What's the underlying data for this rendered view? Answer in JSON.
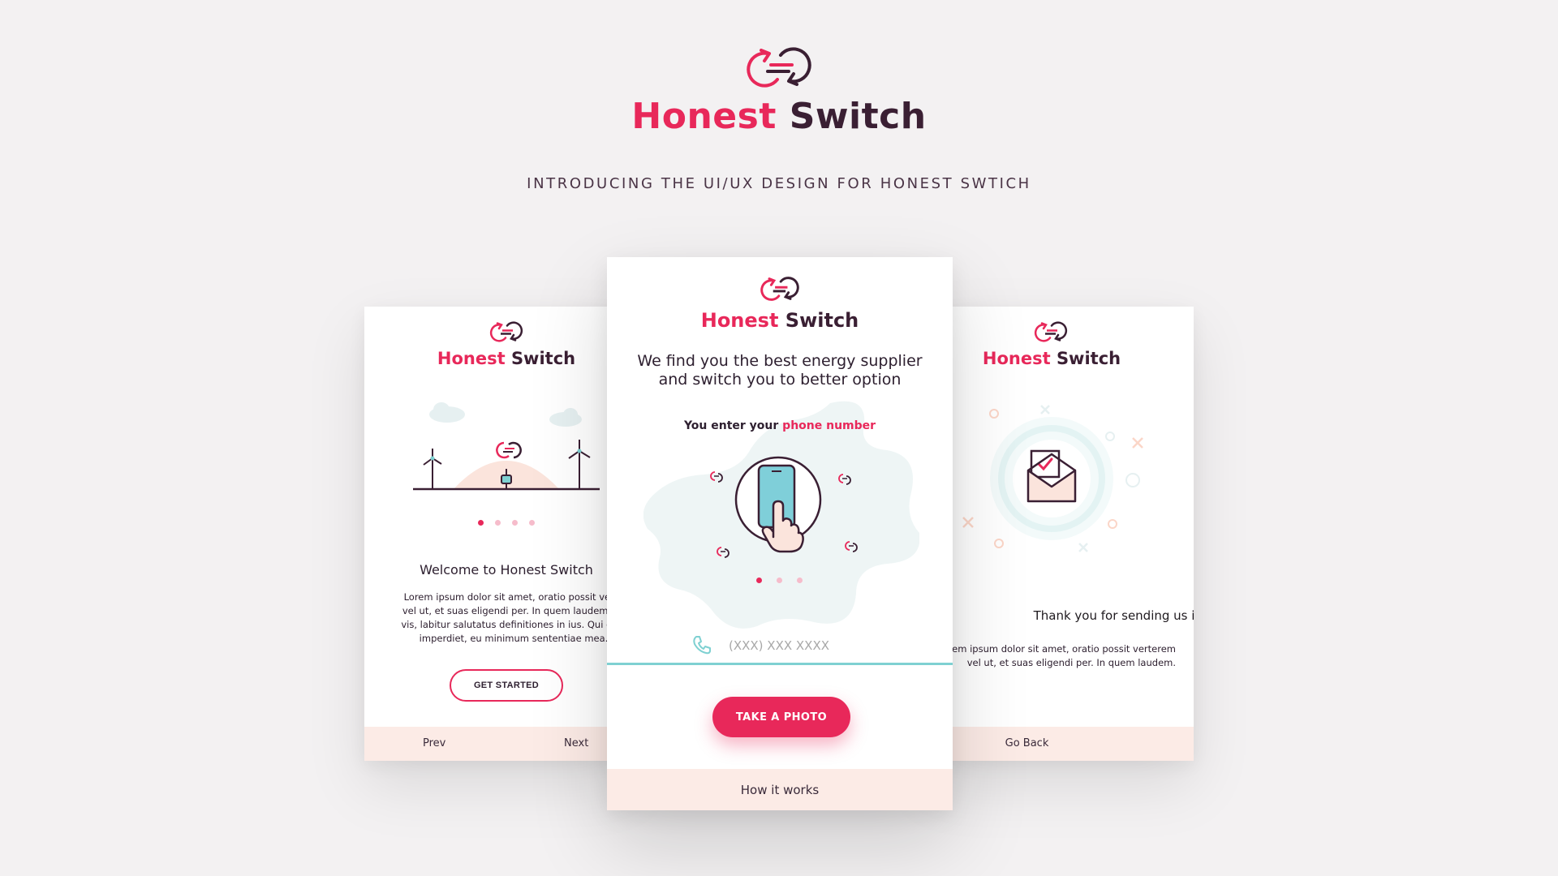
{
  "brand": {
    "name_first": "Honest",
    "name_second": "Switch",
    "tagline": "INTRODUCING THE UI/UX DESIGN FOR HONEST SWTICH",
    "logo_icon": "switch-arrows-logo",
    "colors": {
      "primary": "#e8285a",
      "secondary": "#3a1f33",
      "accent": "#7fd1d2",
      "footer": "#fcebe6",
      "background": "#f3f1f2"
    }
  },
  "screens": {
    "welcome": {
      "heading": "Welcome to Honest Switch",
      "body_lines": [
        "Lorem ipsum dolor sit amet, oratio possit verte",
        "vel ut, et suas eligendi per. In quem laudem scr",
        "vis, labitur salutatus definitiones in ius. Qui cu p",
        "imperdiet, eu minimum sententiae mea."
      ],
      "button_label": "GET STARTED",
      "prev_label": "Prev",
      "next_label": "Next",
      "pager": {
        "pages": 4,
        "active": 1
      }
    },
    "phone": {
      "headline_line1": "We find you the best energy supplier",
      "headline_line2": "and switch you to better option",
      "enter_prefix": "You enter your ",
      "enter_highlight": "phone number",
      "phone_placeholder": "(XXX) XXX XXXX",
      "button_label": "TAKE A PHOTO",
      "footer_label": "How it works",
      "pager": {
        "pages": 3,
        "active": 1
      }
    },
    "thanks": {
      "heading": "Thank you for sending us info!",
      "body_lines": [
        "em ipsum dolor sit amet, oratio possit verterem",
        "vel ut, et suas eligendi per. In quem laudem."
      ],
      "footer_label": "Go Back"
    }
  }
}
